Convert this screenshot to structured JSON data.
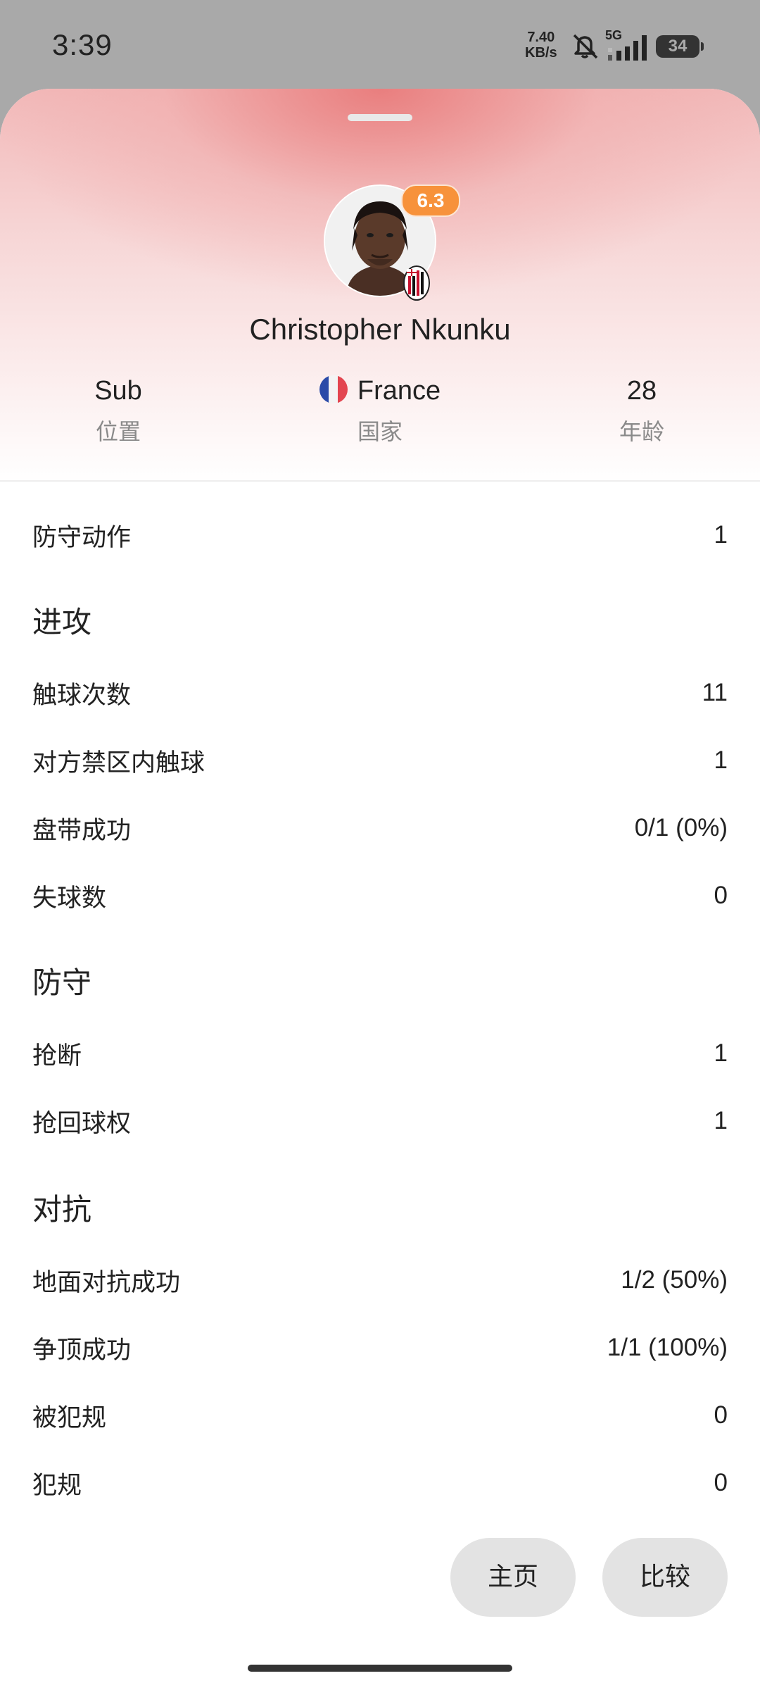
{
  "status_bar": {
    "time": "3:39",
    "net_speed_value": "7.40",
    "net_speed_unit": "KB/s",
    "network_type": "5G",
    "battery": "34",
    "icons": [
      "mute-icon",
      "signal-icon",
      "battery-icon"
    ]
  },
  "player": {
    "name": "Christopher Nkunku",
    "rating": "6.3",
    "rating_color": "#f7923b",
    "club_icon": "ac-milan-badge-icon",
    "position_value": "Sub",
    "position_label": "位置",
    "country_value": "France",
    "country_label": "国家",
    "age_value": "28",
    "age_label": "年龄"
  },
  "top_stats": [
    {
      "label": "防守动作",
      "value": "1"
    }
  ],
  "sections": [
    {
      "title": "进攻",
      "rows": [
        {
          "label": "触球次数",
          "value": "11"
        },
        {
          "label": "对方禁区内触球",
          "value": "1"
        },
        {
          "label": "盘带成功",
          "value": "0/1 (0%)"
        },
        {
          "label": "失球数",
          "value": "0"
        }
      ]
    },
    {
      "title": "防守",
      "rows": [
        {
          "label": "抢断",
          "value": "1"
        },
        {
          "label": "抢回球权",
          "value": "1"
        }
      ]
    },
    {
      "title": "对抗",
      "rows": [
        {
          "label": "地面对抗成功",
          "value": "1/2 (50%)"
        },
        {
          "label": "争顶成功",
          "value": "1/1 (100%)"
        },
        {
          "label": "被犯规",
          "value": "0"
        },
        {
          "label": "犯规",
          "value": "0"
        }
      ]
    }
  ],
  "buttons": {
    "home": "主页",
    "compare": "比较"
  }
}
